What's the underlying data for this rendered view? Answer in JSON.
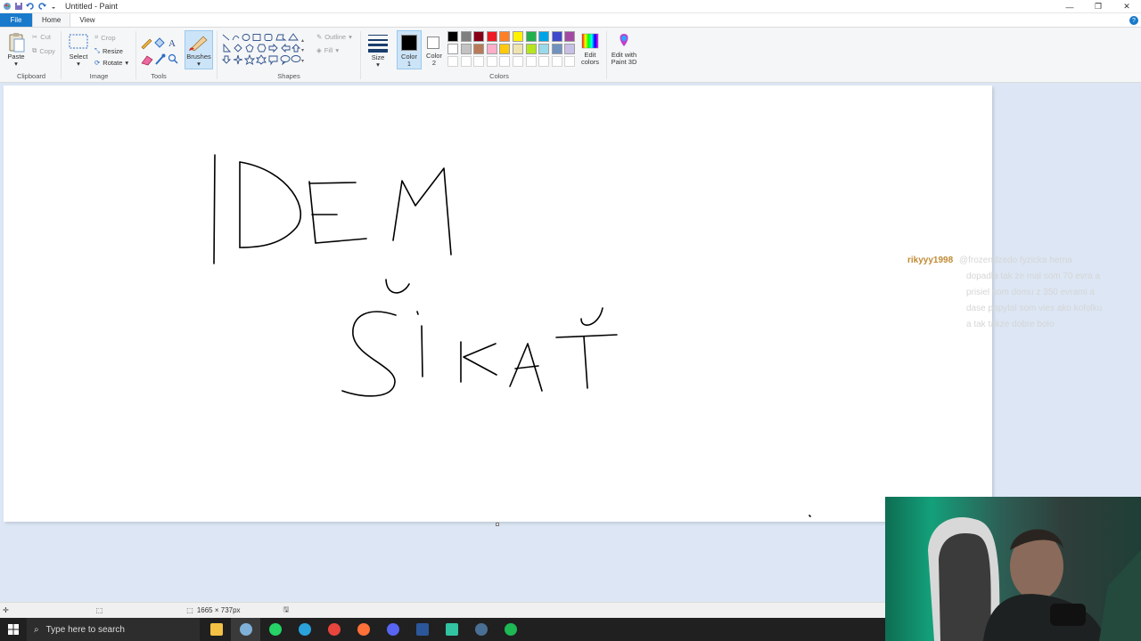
{
  "window": {
    "title": "Untitled - Paint"
  },
  "tabs": [
    {
      "label": "File"
    },
    {
      "label": "Home"
    },
    {
      "label": "View"
    }
  ],
  "ribbon": {
    "clipboard": {
      "paste": "Paste",
      "cut": "Cut",
      "copy": "Copy",
      "group": "Clipboard"
    },
    "image": {
      "select": "Select",
      "crop": "Crop",
      "resize": "Resize",
      "rotate": "Rotate",
      "group": "Image"
    },
    "tools": {
      "group": "Tools"
    },
    "brushes": {
      "label": "Brushes"
    },
    "shapes": {
      "outline": "Outline",
      "fill": "Fill",
      "group": "Shapes"
    },
    "size": {
      "label": "Size"
    },
    "color1": {
      "label": "Color",
      "number": "1"
    },
    "color2": {
      "label": "Color",
      "number": "2"
    },
    "colors": {
      "group": "Colors",
      "edit": "Edit",
      "edit2": "colors"
    },
    "paint3d": {
      "label": "Edit with",
      "label2": "Paint 3D"
    },
    "palette_row1": [
      "#000000",
      "#7f7f7f",
      "#880015",
      "#ed1c24",
      "#ff7f27",
      "#fff200",
      "#22b14c",
      "#00a2e8",
      "#3f48cc",
      "#a349a4"
    ],
    "palette_row2": [
      "#ffffff",
      "#c3c3c3",
      "#b97a57",
      "#ffaec9",
      "#ffc90e",
      "#efe4b0",
      "#b5e61d",
      "#99d9ea",
      "#7092be",
      "#c8bfe7"
    ]
  },
  "canvas": {
    "drawing_text": "IDEM ŠIKAŤ"
  },
  "chat": {
    "username": "rikyyy1998",
    "lines": [
      "@frozendzedo fyzicka herna",
      "dopadla tak ze mal som 70 evra a",
      "prisiel som domu z 350 evrami a",
      "dase popytal som vies ako kofolku",
      "a tak takze dobre bolo"
    ]
  },
  "statusbar": {
    "dimensions": "1665 × 737px"
  },
  "taskbar": {
    "search_placeholder": "Type here to search",
    "apps": [
      {
        "name": "file-explorer",
        "color": "#f4c144"
      },
      {
        "name": "paint",
        "color": "#7fb0d8"
      },
      {
        "name": "whatsapp",
        "color": "#25d366"
      },
      {
        "name": "telegram",
        "color": "#2aa3dc"
      },
      {
        "name": "chrome",
        "color": "#e8453c"
      },
      {
        "name": "firefox",
        "color": "#ff7139"
      },
      {
        "name": "discord",
        "color": "#5865f2"
      },
      {
        "name": "word",
        "color": "#2b579a"
      },
      {
        "name": "streamlabs",
        "color": "#31c3a2"
      },
      {
        "name": "steam",
        "color": "#4a6f94"
      },
      {
        "name": "spotify",
        "color": "#1db954"
      }
    ]
  }
}
